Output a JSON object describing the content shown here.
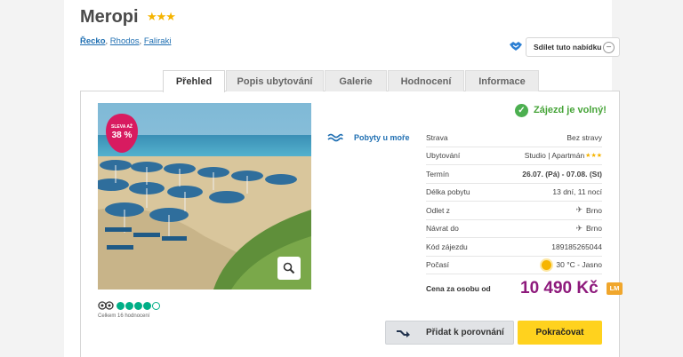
{
  "hotel": {
    "name": "Meropi",
    "stars": "★★★"
  },
  "breadcrumb": {
    "country": "Řecko",
    "region": "Rhodos",
    "city": "Faliraki"
  },
  "share": {
    "label": "Sdílet tuto nabídku"
  },
  "tabs": [
    {
      "label": "Přehled",
      "active": true
    },
    {
      "label": "Popis ubytování"
    },
    {
      "label": "Galerie"
    },
    {
      "label": "Hodnocení"
    },
    {
      "label": "Informace"
    }
  ],
  "photo": {
    "badge_top": "SLEVA AŽ",
    "badge_value": "38 %"
  },
  "tripadvisor": {
    "rating": 4,
    "max": 5,
    "reviews": "Celkem 16 hodnocení"
  },
  "feature": {
    "label": "Pobyty u moře"
  },
  "availability": {
    "label": "Zájezd je volný!"
  },
  "details": [
    {
      "label": "Strava",
      "value": "Bez stravy"
    },
    {
      "label": "Ubytování",
      "value": "Studio | Apartmán",
      "stars": "★★★"
    },
    {
      "label": "Termín",
      "value": "26.07. (Pá) - 07.08. (St)",
      "bold": true
    },
    {
      "label": "Délka pobytu",
      "value": "13 dní, 11 nocí"
    },
    {
      "label": "Odlet z",
      "value": "Brno",
      "icon": "plane-icon"
    },
    {
      "label": "Návrat do",
      "value": "Brno",
      "icon": "plane-icon"
    },
    {
      "label": "Kód zájezdu",
      "value": "189185265044"
    },
    {
      "label": "Počasí",
      "value": "30 °C - Jasno",
      "icon": "sun-icon"
    }
  ],
  "price": {
    "label": "Cena za osobu od",
    "value": "10 490 Kč",
    "tag": "LM"
  },
  "buttons": {
    "compare": "Přidat k porovnání",
    "continue": "Pokračovat"
  },
  "colors": {
    "price": "#8e1a7c",
    "cta": "#ffd21e",
    "link": "#1f6fb2",
    "success": "#4caf50",
    "badge": "#d81b60"
  }
}
